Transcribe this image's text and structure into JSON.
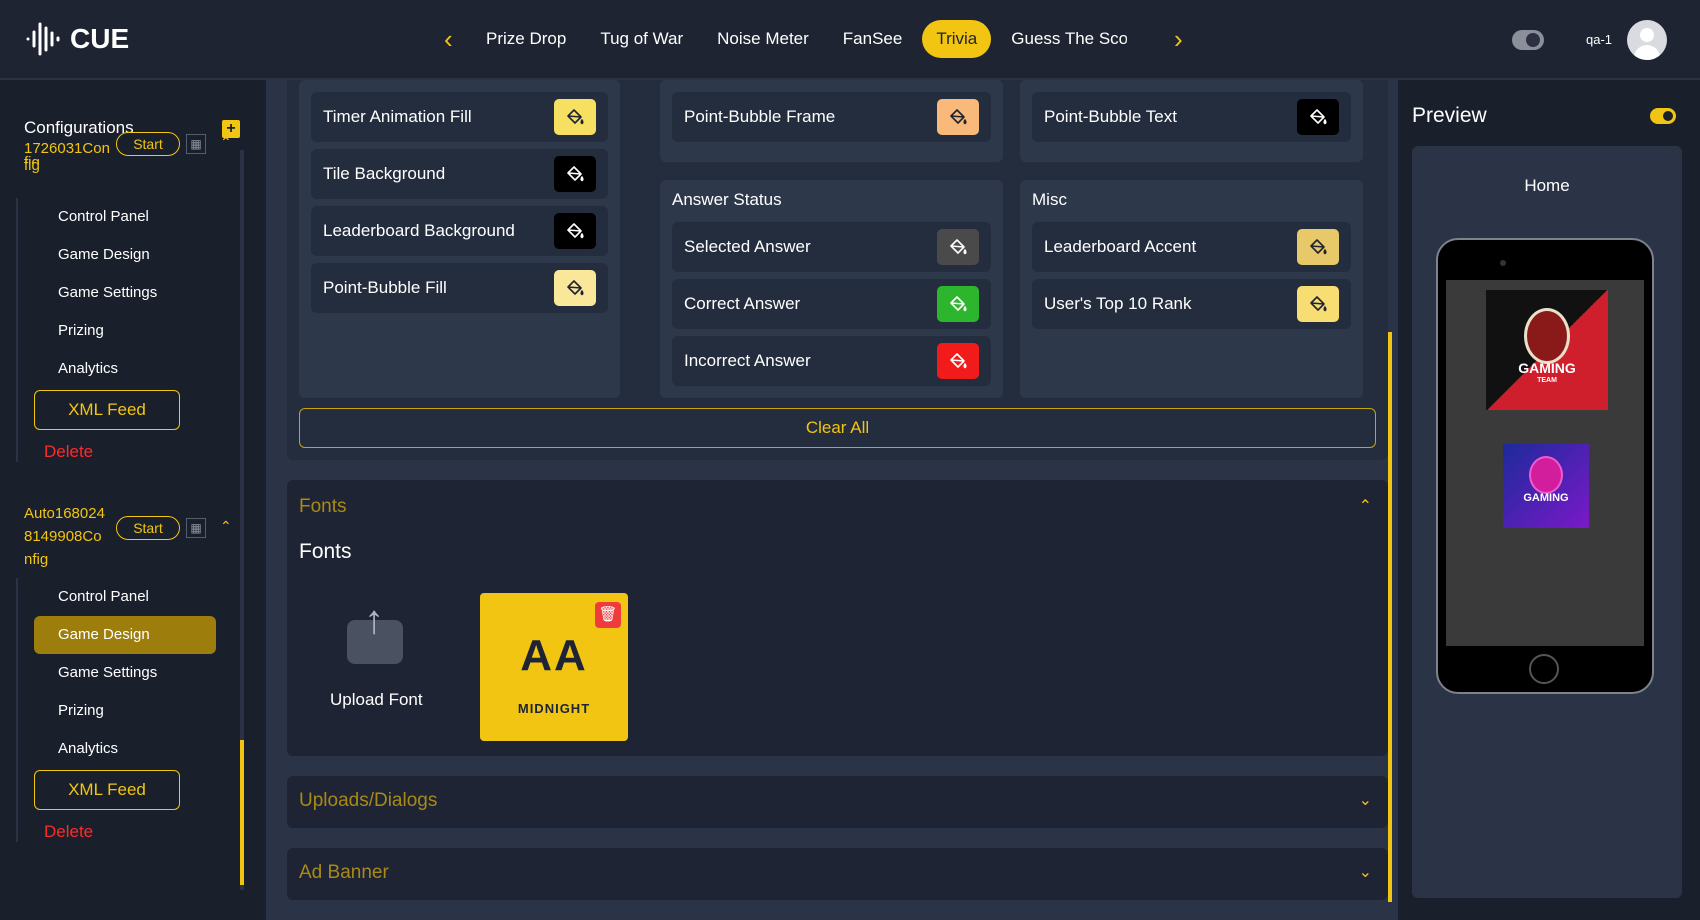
{
  "app": {
    "name": "CUE"
  },
  "nav": {
    "tabs": [
      {
        "label": "Prize Drop"
      },
      {
        "label": "Tug of War"
      },
      {
        "label": "Noise Meter"
      },
      {
        "label": "FanSee"
      },
      {
        "label": "Trivia",
        "active": true
      },
      {
        "label": "Guess The Sco"
      }
    ],
    "user": "qa-1"
  },
  "sidebar": {
    "heading": "Configurations",
    "configs": [
      {
        "name": "1726031Config",
        "start_label": "Start",
        "items": [
          "Control Panel",
          "Game Design",
          "Game Settings",
          "Prizing",
          "Analytics"
        ],
        "xml_label": "XML Feed",
        "delete_label": "Delete"
      },
      {
        "name": "Auto1680248149908Config",
        "name_lines": [
          "Auto168024",
          "8149908Co",
          "nfig"
        ],
        "start_label": "Start",
        "items": [
          "Control Panel",
          "Game Design",
          "Game Settings",
          "Prizing",
          "Analytics"
        ],
        "active_item": "Game Design",
        "xml_label": "XML Feed",
        "delete_label": "Delete"
      }
    ],
    "first_name_tail": "fig"
  },
  "colors": {
    "col1": [
      {
        "label": "Timer Animation Fill",
        "color": "#f7e061"
      },
      {
        "label": "Tile Background",
        "color": "#000000"
      },
      {
        "label": "Leaderboard Background",
        "color": "#000000"
      },
      {
        "label": "Point-Bubble Fill",
        "color": "#fbe79a"
      }
    ],
    "col2": [
      {
        "label": "Point-Bubble Frame",
        "color": "#f9b97a"
      }
    ],
    "col3": [
      {
        "label": "Point-Bubble Text",
        "color": "#000000"
      }
    ],
    "answer_status": {
      "title": "Answer Status",
      "items": [
        {
          "label": "Selected Answer",
          "color": "#4a4a4a"
        },
        {
          "label": "Correct Answer",
          "color": "#2db52d"
        },
        {
          "label": "Incorrect Answer",
          "color": "#f21b1b"
        }
      ]
    },
    "misc": {
      "title": "Misc",
      "items": [
        {
          "label": "Leaderboard Accent",
          "color": "#e8c96a"
        },
        {
          "label": "User's Top 10 Rank",
          "color": "#f8de72"
        }
      ]
    },
    "clear_label": "Clear All"
  },
  "fonts": {
    "section_title": "Fonts",
    "title": "Fonts",
    "upload_label": "Upload Font",
    "card": {
      "preview": "AA",
      "name": "MIDNIGHT"
    }
  },
  "sections": [
    {
      "title": "Uploads/Dialogs"
    },
    {
      "title": "Ad Banner"
    }
  ],
  "preview": {
    "title": "Preview",
    "screen_title": "Home",
    "logo1_text": "GAMING",
    "logo1_sub": "TEAM",
    "logo2_text": "GAMING"
  },
  "palette": {
    "accent": "#f2c512",
    "danger": "#ff2a2a"
  }
}
